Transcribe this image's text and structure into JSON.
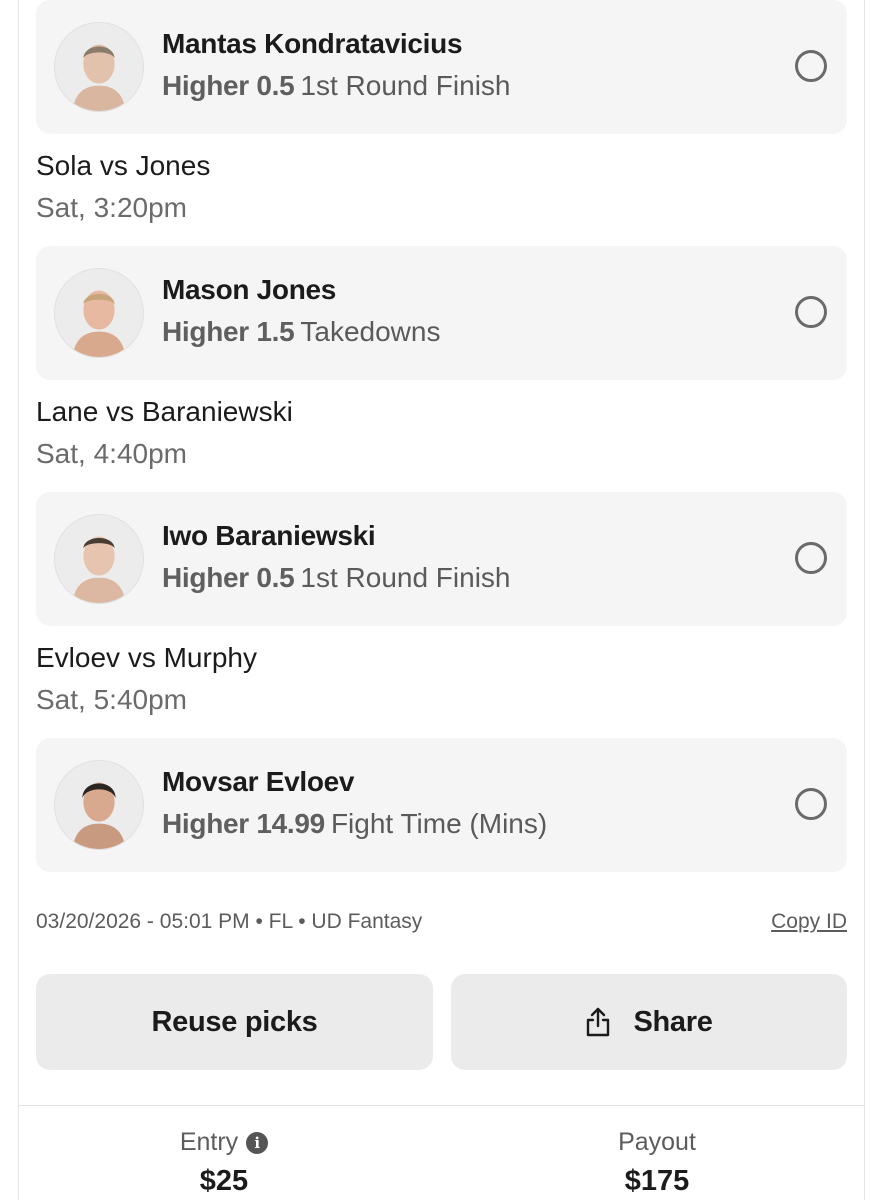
{
  "picks": [
    {
      "player": "Mantas Kondratavicius",
      "direction": "Higher 0.5",
      "stat": "1st Round Finish",
      "avatar": "fighter-portrait"
    },
    {
      "matchup": "Sola vs Jones",
      "time": "Sat, 3:20pm",
      "player": "Mason Jones",
      "direction": "Higher 1.5",
      "stat": "Takedowns",
      "avatar": "fighter-portrait"
    },
    {
      "matchup": "Lane vs Baraniewski",
      "time": "Sat, 4:40pm",
      "player": "Iwo Baraniewski",
      "direction": "Higher 0.5",
      "stat": "1st Round Finish",
      "avatar": "fighter-portrait"
    },
    {
      "matchup": "Evloev vs Murphy",
      "time": "Sat, 5:40pm",
      "player": "Movsar Evloev",
      "direction": "Higher 14.99",
      "stat": "Fight Time (Mins)",
      "avatar": "fighter-portrait"
    }
  ],
  "meta": {
    "entry_info": "03/20/2026 - 05:01 PM • FL • UD Fantasy",
    "copy_id": "Copy ID"
  },
  "actions": {
    "reuse_label": "Reuse picks",
    "share_label": "Share",
    "share_icon": "share-icon"
  },
  "footer": {
    "entry_label": "Entry",
    "entry_value": "$25",
    "info_icon": "info-icon",
    "payout_label": "Payout",
    "payout_value": "$175"
  },
  "colors": {
    "card_bg": "#f5f5f5",
    "button_bg": "#ebebeb",
    "text_primary": "#1b1b1b",
    "text_secondary": "#6b6b6b"
  }
}
